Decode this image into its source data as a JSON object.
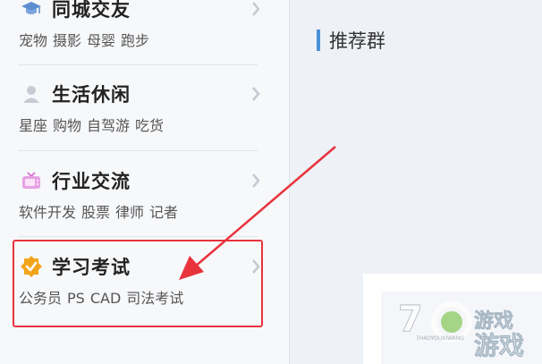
{
  "sidebar": {
    "categories": [
      {
        "title": "同城交友",
        "icon": "graduation-cap-icon",
        "subs": [
          "宠物",
          "摄影",
          "母婴",
          "跑步"
        ]
      },
      {
        "title": "生活休闲",
        "icon": "person-icon",
        "subs": [
          "星座",
          "购物",
          "自驾游",
          "吃货"
        ]
      },
      {
        "title": "行业交流",
        "icon": "tv-icon",
        "subs": [
          "软件开发",
          "股票",
          "律师",
          "记者"
        ]
      },
      {
        "title": "学习考试",
        "icon": "badge-check-icon",
        "subs": [
          "公务员",
          "PS",
          "CAD",
          "司法考试"
        ]
      }
    ]
  },
  "main": {
    "section_title": "推荐群"
  },
  "colors": {
    "highlight": "#e8333d",
    "accent": "#4a90d9"
  }
}
